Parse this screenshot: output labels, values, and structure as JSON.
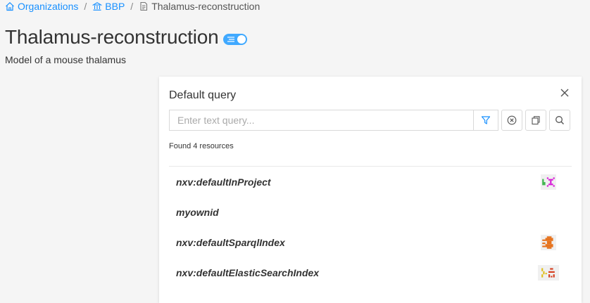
{
  "breadcrumb": {
    "organizations": "Organizations",
    "org": "BBP",
    "project": "Thalamus-reconstruction",
    "separator": "/"
  },
  "page": {
    "title": "Thalamus-reconstruction",
    "description": "Model of a mouse thalamus"
  },
  "query_panel": {
    "title": "Default query",
    "search_placeholder": "Enter text query...",
    "search_value": "",
    "found_text": "Found 4 resources",
    "results": [
      {
        "label": "nxv:defaultInProject",
        "avatar_icon": "identicon-green-magenta"
      },
      {
        "label": "myownid",
        "avatar_icon": ""
      },
      {
        "label": "nxv:defaultSparqlIndex",
        "avatar_icon": "identicon-orange"
      },
      {
        "label": "nxv:defaultElasticSearchIndex",
        "avatar_icon": "identicon-yellow-red"
      }
    ]
  },
  "colors": {
    "link": "#1890ff",
    "toggle": "#40a9ff",
    "background": "#f5f5f5"
  }
}
